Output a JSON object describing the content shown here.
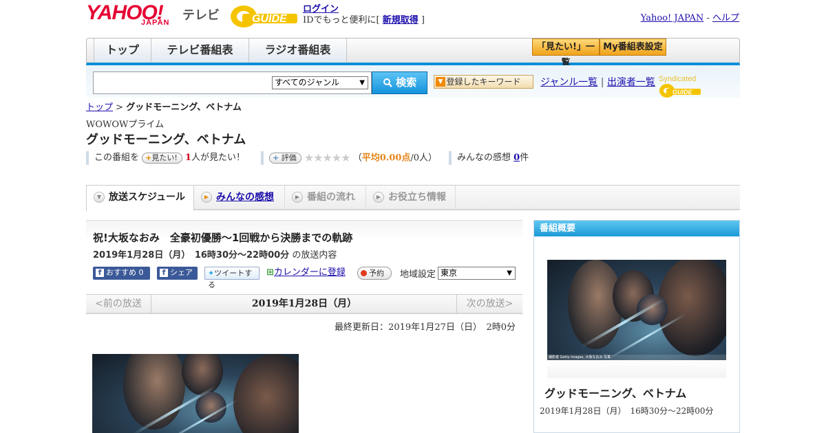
{
  "header": {
    "logo_yahoo": "YAHOO!",
    "logo_japan": "JAPAN",
    "logo_tv": "テレビ",
    "gguide": "GUIDE",
    "login_link": "ログイン",
    "login_prefix": "IDでもっと便利に[ ",
    "signup_link": "新規取得",
    "login_suffix": " ]",
    "yahoo_japan_link": "Yahoo! JAPAN",
    "separator": " - ",
    "help_link": "ヘルプ"
  },
  "nav": {
    "tabs": [
      "トップ",
      "テレビ番組表",
      "ラジオ番組表"
    ],
    "mitai_list": "「見たい!」一覧",
    "my_schedule": "My番組表設定"
  },
  "search": {
    "genre_selected": "すべてのジャンル",
    "button": "検索",
    "keyword_button": "登録したキーワード",
    "genre_list_link": "ジャンル一覧",
    "divider": "|",
    "cast_list_link": "出演者一覧",
    "syndicated": "Syndicated",
    "syndicated_logo": "GUIDE"
  },
  "breadcrumb": {
    "top": "トップ",
    "sep": " > ",
    "current": "グッドモーニング、ベトナム"
  },
  "program": {
    "channel": "WOWOWプライム",
    "title": "グッドモーニング、ベトナム",
    "mitai_prefix": "この番組を",
    "mitai_button": "見たい!",
    "mitai_count": "1",
    "mitai_suffix": "人が見たい！",
    "rate_button": "評価",
    "stars": "★★★★★",
    "avg_open": "（",
    "avg": "平均0.00点",
    "avg_count": "/0人）",
    "comments_label": "みんなの感想 ",
    "comments_count": "0",
    "comments_unit": "件"
  },
  "subtabs": [
    "放送スケジュール",
    "みんなの感想",
    "番組の流れ",
    "お役立ち情報"
  ],
  "episode": {
    "title": "祝!大坂なおみ　全豪初優勝～1回戦から決勝までの軌跡",
    "datetime": "2019年1月28日（月）　16時30分～22時00分",
    "datetime_suffix": " の放送内容",
    "fb_label": "おすすめ 0",
    "share_label": "シェア",
    "tweet_label": "ツイートする",
    "calendar_link": "カレンダーに登録",
    "reserve_label": "予約",
    "region_label": "地域設定",
    "region_selected": "東京"
  },
  "pager": {
    "prev": "<前の放送",
    "current": "2019年1月28日（月）",
    "next": "次の放送>"
  },
  "updated": "最終更新日：2019年1月27日（日）　2時0分",
  "sidebar": {
    "heading": "番組概要",
    "photo_caption": "撮影者 Getty Images, 大坂なおみ 写真",
    "title": "グッドモーニング、ベトナム",
    "time": "2019年1月28日（月）　16時30分～22時00分"
  },
  "colors": {
    "brand_red": "#e60033",
    "accent_blue": "#0b8ed8",
    "link": "#1a0dab"
  }
}
